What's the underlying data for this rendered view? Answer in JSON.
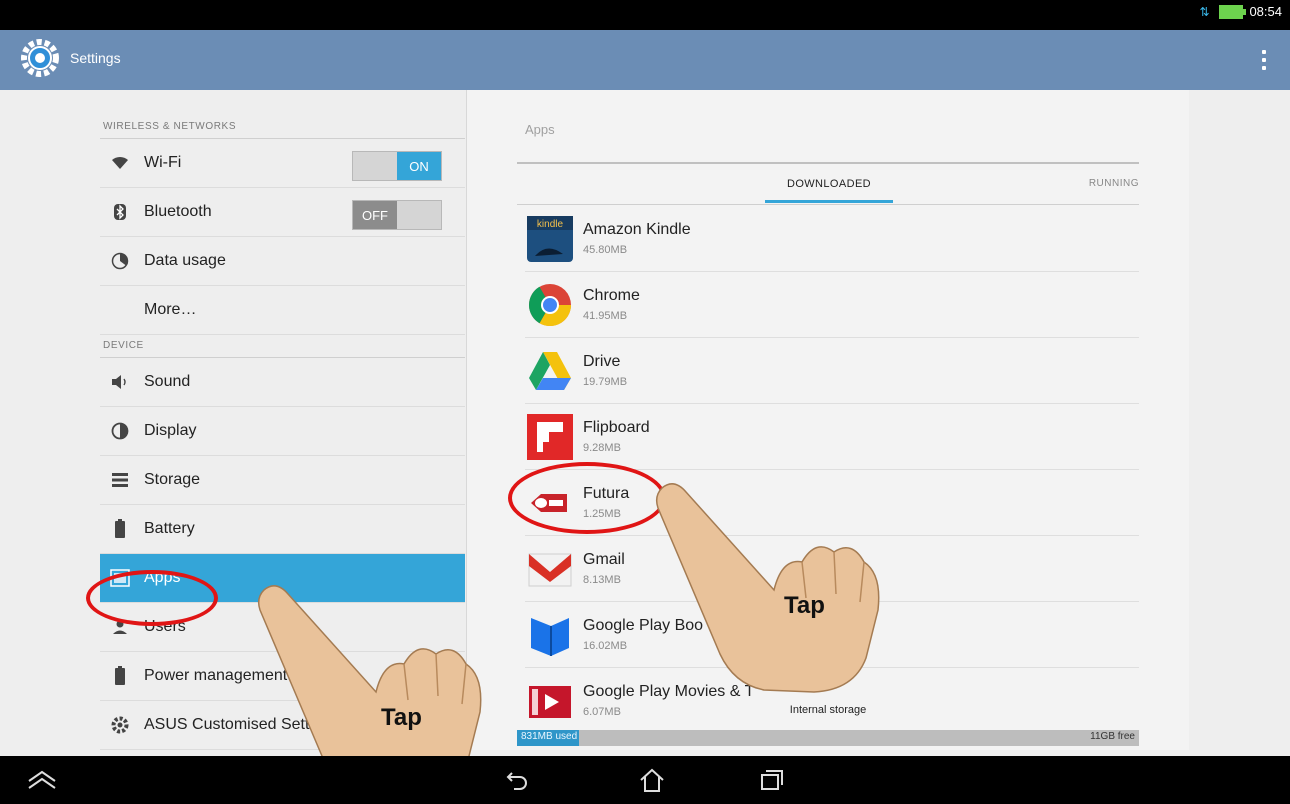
{
  "status_bar": {
    "time": "08:54"
  },
  "action_bar": {
    "title": "Settings"
  },
  "left_pane": {
    "sections": [
      {
        "header": "WIRELESS & NETWORKS",
        "items": [
          {
            "label": "Wi-Fi",
            "icon": "wifi-icon",
            "toggle": {
              "off": "",
              "on": "ON",
              "state": "on"
            }
          },
          {
            "label": "Bluetooth",
            "icon": "bluetooth-icon",
            "toggle": {
              "off": "OFF",
              "on": "",
              "state": "off"
            }
          },
          {
            "label": "Data usage",
            "icon": "data-usage-icon"
          },
          {
            "label": "More…"
          }
        ]
      },
      {
        "header": "DEVICE",
        "items": [
          {
            "label": "Sound",
            "icon": "sound-icon"
          },
          {
            "label": "Display",
            "icon": "display-icon"
          },
          {
            "label": "Storage",
            "icon": "storage-icon"
          },
          {
            "label": "Battery",
            "icon": "battery-icon"
          },
          {
            "label": "Apps",
            "icon": "apps-icon",
            "selected": true
          },
          {
            "label": "Users",
            "icon": "users-icon"
          },
          {
            "label": "Power management",
            "icon": "power-management-icon"
          },
          {
            "label": "ASUS Customised Settin",
            "icon": "asus-settings-icon"
          }
        ]
      }
    ]
  },
  "right_pane": {
    "title": "Apps",
    "tabs": {
      "downloaded": "DOWNLOADED",
      "running": "RUNNING"
    },
    "apps": [
      {
        "name": "Amazon Kindle",
        "size": "45.80MB",
        "icon": "kindle-icon",
        "color": "#1d4f7f"
      },
      {
        "name": "Chrome",
        "size": "41.95MB",
        "icon": "chrome-icon",
        "color": "#db4437"
      },
      {
        "name": "Drive",
        "size": "19.79MB",
        "icon": "drive-icon",
        "color": "#1da462"
      },
      {
        "name": "Flipboard",
        "size": "9.28MB",
        "icon": "flipboard-icon",
        "color": "#e12828"
      },
      {
        "name": "Futura",
        "size": "1.25MB",
        "icon": "futura-icon",
        "color": "#c8232a"
      },
      {
        "name": "Gmail",
        "size": "8.13MB",
        "icon": "gmail-icon",
        "color": "#d93025"
      },
      {
        "name": "Google Play Boo",
        "size": "16.02MB",
        "icon": "google-play-books-icon",
        "color": "#1a73e8"
      },
      {
        "name": "Google Play Movies & T",
        "size": "6.07MB",
        "icon": "google-play-movies-icon",
        "color": "#c5162b"
      }
    ],
    "storage": {
      "label": "Internal storage",
      "used": "831MB used",
      "free": "11GB free",
      "used_fraction": 0.1
    }
  },
  "annotations": {
    "tap_left": "Tap",
    "tap_right": "Tap"
  }
}
